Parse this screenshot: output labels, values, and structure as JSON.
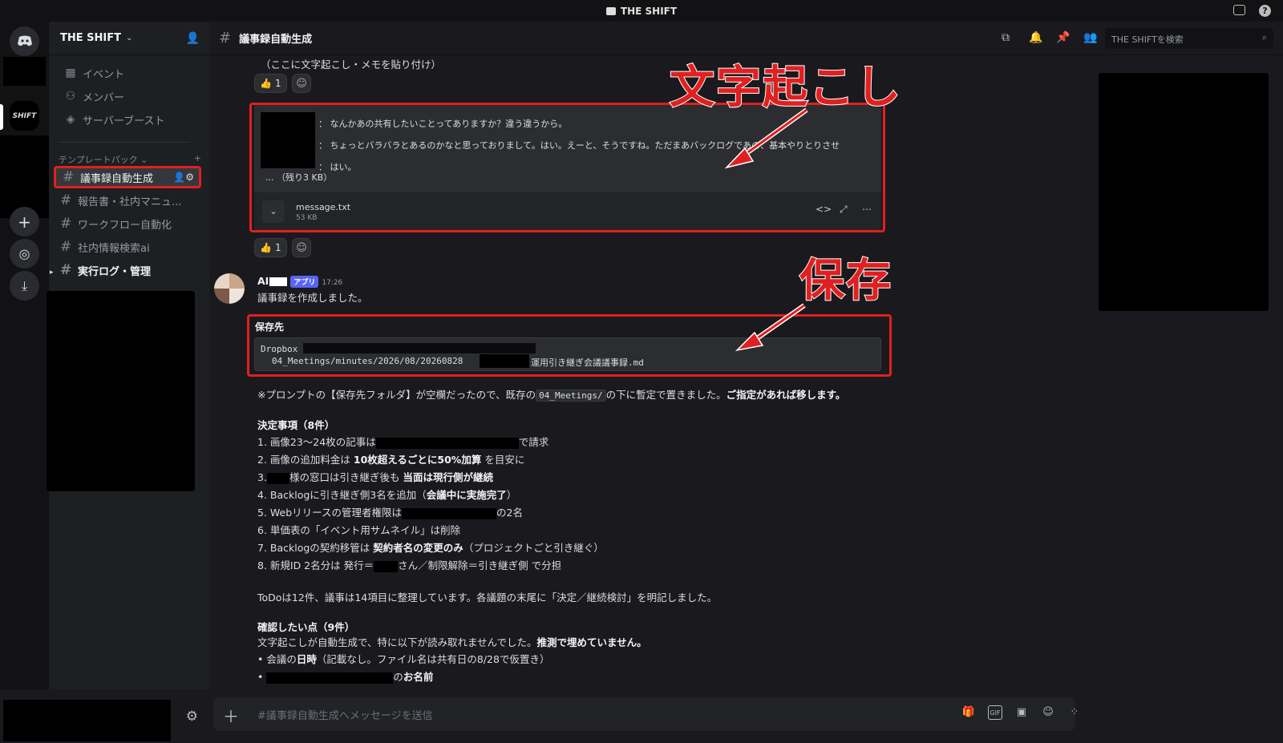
{
  "window": {
    "title": "THE SHIFT"
  },
  "server": {
    "name": "THE SHIFT",
    "rail_label": "SHIFT"
  },
  "sidebar": {
    "top_items": [
      {
        "label": "イベント",
        "icon": "calendar-icon"
      },
      {
        "label": "メンバー",
        "icon": "members-icon"
      },
      {
        "label": "サーバーブースト",
        "icon": "boost-icon"
      }
    ],
    "category": "テンプレートパック",
    "channels": [
      {
        "label": "議事録自動生成",
        "active": true
      },
      {
        "label": "報告書・社内マニュ..."
      },
      {
        "label": "ワークフロー自動化"
      },
      {
        "label": "社内情報検索ai"
      },
      {
        "label": "実行ログ・管理",
        "bold": true
      }
    ]
  },
  "header": {
    "channel": "議事録自動生成",
    "search_placeholder": "THE SHIFTを検索"
  },
  "messages": {
    "paste_hint": "（ここに文字起こし・メモを貼り付け）",
    "reaction_count_1": "1",
    "transcript_lines": [
      "：  なんかあの共有したいことってありますか？違う違うから。",
      "：  ちょっとバラバラとあるのかなと思っておりまして。はい。えーと、そうですね。ただまあバックログであの、基本やりとりさせ",
      "：  はい。"
    ],
    "transcript_more": "...  （残り3 KB）",
    "attachment": {
      "name": "message.txt",
      "size": "53 KB"
    },
    "reaction_count_2": "1",
    "bot": {
      "name": "AI",
      "badge": "アプリ",
      "time": "17:26",
      "intro": "議事録を作成しました。",
      "save_heading": "保存先",
      "save_line1": "Dropbox",
      "save_line2a": "04_Meetings/minutes/2026/08/20260828",
      "save_line2b": "運用引き継ぎ会議議事録.md",
      "note_a": "※プロンプトの【保存先フォルダ】が空欄だったので、既存の",
      "note_code": "04_Meetings/",
      "note_b": "の下に暫定で置きました。",
      "note_bold": "ご指定があれば移します。",
      "decisions_heading": "決定事項（8件）",
      "d1a": "1. 画像23～24枚の記事は",
      "d1b": "で請求",
      "d2a": "2. 画像の追加料金は",
      "d2b": "10枚超えるごとに50%加算",
      "d2c": "を目安に",
      "d3a": "3.",
      "d3b": "様の窓口は引き継ぎ後も",
      "d3c": "当面は現行側が継続",
      "d4a": "4. Backlogに引き継ぎ側3名を追加（",
      "d4b": "会議中に実施完了",
      "d4c": "）",
      "d5a": "5. Webリリースの管理者権限は",
      "d5b": "の2名",
      "d6": "6. 単価表の「イベント用サムネイル」は削除",
      "d7a": "7. Backlogの契約移管は",
      "d7b": "契約者名の変更のみ",
      "d7c": "（プロジェクトごと引き継ぐ）",
      "d8a": "8. 新規ID 2名分は 発行＝",
      "d8b": "さん／制限解除＝引き継ぎ側 で分担",
      "summary": "ToDoは12件、議事は14項目に整理しています。各議題の末尾に「決定／継続検討」を明記しました。",
      "confirm_heading": "確認したい点（9件）",
      "confirm_a": "文字起こしが自動生成で、特に以下が読み取れませんでした。",
      "confirm_b": "推測で埋めていません。",
      "b1a": "• 会議の",
      "b1b": "日時",
      "b1c": "（記載なし。ファイル名は共有日の8/28で仮置き）",
      "b2a": "•",
      "b2b": "の",
      "b2c": "お名前"
    }
  },
  "annotations": {
    "transcript": "文字起こし",
    "save": "保存"
  },
  "composer": {
    "placeholder": "#議事録自動生成へメッセージを送信"
  },
  "colors": {
    "accent_red": "#e02020",
    "badge_blue": "#5865f2",
    "bg": "#1a1a1e"
  }
}
